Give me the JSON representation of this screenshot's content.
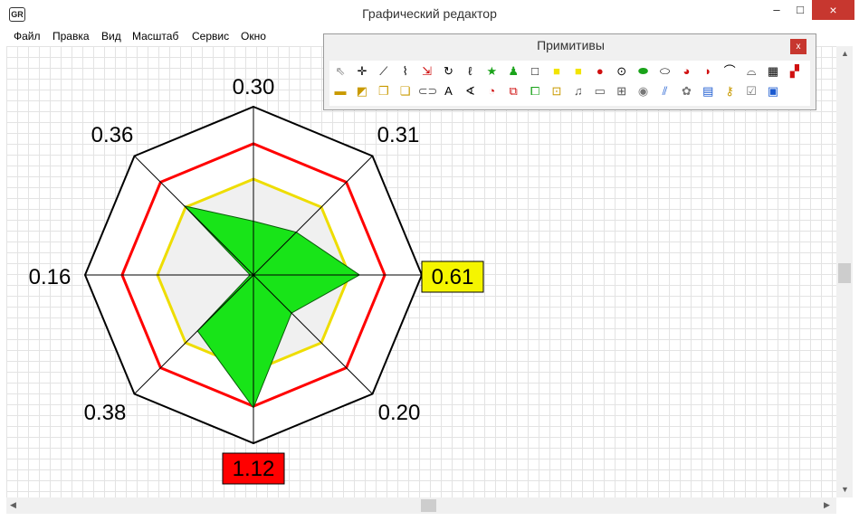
{
  "window": {
    "title": "Графический редактор",
    "icon": "app-logo-icon",
    "minimize": "–",
    "maximize": "□",
    "close": "×"
  },
  "menu": [
    "Файл",
    "Правка",
    "Вид",
    "Масштаб",
    "Сервис",
    "Окно"
  ],
  "palette": {
    "title": "Примитивы",
    "close": "x",
    "tools": [
      {
        "name": "pointer-tool-icon",
        "glyph": "⇖",
        "color": "#888888"
      },
      {
        "name": "point-tool-icon",
        "glyph": "✛",
        "color": "#000000"
      },
      {
        "name": "line-tool-icon",
        "glyph": "⟋",
        "color": "#000000"
      },
      {
        "name": "polyline-tool-icon",
        "glyph": "⌇",
        "color": "#000000"
      },
      {
        "name": "connector-tool-icon",
        "glyph": "⇲",
        "color": "#cc0000"
      },
      {
        "name": "arc-tool-icon",
        "glyph": "↻",
        "color": "#000000"
      },
      {
        "name": "curve-tool-icon",
        "glyph": "ℓ",
        "color": "#000000"
      },
      {
        "name": "star-tool-icon",
        "glyph": "★",
        "color": "#1aa31a"
      },
      {
        "name": "figure-tool-icon",
        "glyph": "♟",
        "color": "#1aa31a"
      },
      {
        "name": "rectangle-tool-icon",
        "glyph": "□",
        "color": "#000000"
      },
      {
        "name": "filled-rectangle-tool-icon",
        "glyph": "■",
        "color": "#f2e400"
      },
      {
        "name": "square-tool-icon",
        "glyph": "■",
        "color": "#f2e400"
      },
      {
        "name": "filled-circle-tool-icon",
        "glyph": "●",
        "color": "#d01010"
      },
      {
        "name": "circle-tool-icon",
        "glyph": "⊙",
        "color": "#000000"
      },
      {
        "name": "filled-ellipse-tool-icon",
        "glyph": "⬬",
        "color": "#1aa31a"
      },
      {
        "name": "ellipse-tool-icon",
        "glyph": "⬭",
        "color": "#000000"
      },
      {
        "name": "pie-tool-icon",
        "glyph": "◕",
        "color": "#d01010"
      },
      {
        "name": "half-circle-tool-icon",
        "glyph": "◗",
        "color": "#d01010"
      },
      {
        "name": "arc-points-tool-icon",
        "glyph": "⌒",
        "color": "#000000"
      },
      {
        "name": "dashed-arc-tool-icon",
        "glyph": "⌓",
        "color": "#000000"
      },
      {
        "name": "table-tool-icon",
        "glyph": "▦",
        "color": "#000000"
      },
      {
        "name": "block-tool-icon",
        "glyph": "▞",
        "color": "#d01010"
      },
      {
        "name": "image-tool-icon",
        "glyph": "▬",
        "color": "#c99a00"
      },
      {
        "name": "eraser-tool-icon",
        "glyph": "◩",
        "color": "#c99a00"
      },
      {
        "name": "copy-tool-icon",
        "glyph": "❐",
        "color": "#c99a00"
      },
      {
        "name": "layers-tool-icon",
        "glyph": "❏",
        "color": "#c99a00"
      },
      {
        "name": "button-shape-tool-icon",
        "glyph": "⊂⊃",
        "color": "#666666"
      },
      {
        "name": "text-tool-icon",
        "glyph": "A",
        "color": "#000000"
      },
      {
        "name": "angle-tool-icon",
        "glyph": "∢",
        "color": "#000000"
      },
      {
        "name": "clock-tool-icon",
        "glyph": "◔",
        "color": "#d01010"
      },
      {
        "name": "transform-tool-icon",
        "glyph": "⧉",
        "color": "#d01010"
      },
      {
        "name": "group-tool-icon",
        "glyph": "⧠",
        "color": "#1aa31a"
      },
      {
        "name": "frame-tool-icon",
        "glyph": "⊡",
        "color": "#c99a00"
      },
      {
        "name": "sound-tool-icon",
        "glyph": "♫",
        "color": "#555555"
      },
      {
        "name": "window-tool-icon",
        "glyph": "▭",
        "color": "#555555"
      },
      {
        "name": "tree-tool-icon",
        "glyph": "⊞",
        "color": "#555555"
      },
      {
        "name": "radio-tool-icon",
        "glyph": "◉",
        "color": "#777777"
      },
      {
        "name": "chart-tool-icon",
        "glyph": "⫽",
        "color": "#1a5ad0"
      },
      {
        "name": "gear-tool-icon",
        "glyph": "✿",
        "color": "#777777"
      },
      {
        "name": "document-tool-icon",
        "glyph": "▤",
        "color": "#1a5ad0"
      },
      {
        "name": "key-tool-icon",
        "glyph": "⚷",
        "color": "#c99a00"
      },
      {
        "name": "checkbox-tool-icon",
        "glyph": "☑",
        "color": "#777777"
      },
      {
        "name": "video-tool-icon",
        "glyph": "▣",
        "color": "#1a5ad0"
      }
    ]
  },
  "chart_data": {
    "type": "radar",
    "axes": 8,
    "axis_labels": [
      "0.30",
      "0.31",
      "0.61",
      "0.20",
      "1.12",
      "0.38",
      "0.16",
      "0.36"
    ],
    "highlighted_labels": [
      {
        "index": 2,
        "color": "#f5f500"
      },
      {
        "index": 4,
        "color": "#ff0000"
      }
    ],
    "rings": [
      {
        "level": 1.0,
        "color": "#000000",
        "fill": "#ffffff"
      },
      {
        "level": 0.78,
        "color": "#ff0000",
        "fill": "#ffffff"
      },
      {
        "level": 0.57,
        "color": "#eedd00",
        "fill": "#f0f0f0"
      }
    ],
    "series_fill": "#18e418",
    "series_normalized": [
      0.32,
      0.36,
      0.63,
      0.32,
      0.79,
      0.47,
      0.02,
      0.58
    ],
    "axis_color": "#000000"
  }
}
